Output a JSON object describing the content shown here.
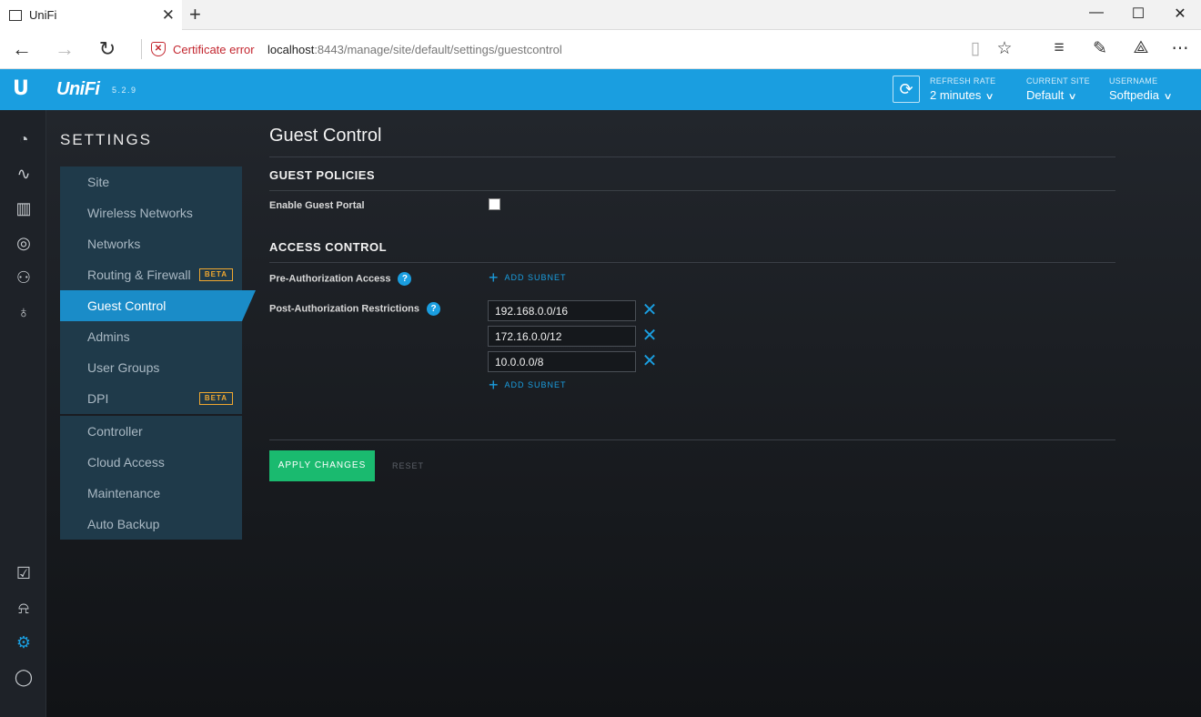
{
  "browser": {
    "tab_title": "UniFi",
    "tab_close": "✕",
    "new_tab": "+",
    "window_controls": {
      "minimize": "—",
      "maximize": "☐",
      "close": "✕"
    },
    "nav": {
      "back": "←",
      "forward": "→",
      "refresh": "↻"
    },
    "cert_error": "Certificate error",
    "url_host": "localhost",
    "url_path": ":8443/manage/site/default/settings/guestcontrol",
    "toolbar_icons": [
      "reading-view-icon",
      "favorite-star-icon",
      "hub-icon",
      "web-note-icon",
      "share-icon",
      "more-icon"
    ]
  },
  "header": {
    "brand": "UniFi",
    "version": "5.2.9",
    "refresh_rate_label": "REFRESH RATE",
    "refresh_rate_value": "2 minutes",
    "current_site_label": "CURRENT SITE",
    "current_site_value": "Default",
    "username_label": "USERNAME",
    "username_value": "Softpedia",
    "accent_color": "#1a9ee0"
  },
  "rail_icons": [
    "dashboard-icon",
    "statistics-icon",
    "map-icon",
    "devices-icon",
    "clients-icon",
    "insights-icon",
    "events-icon",
    "alerts-icon",
    "settings-icon",
    "chat-icon"
  ],
  "settings": {
    "title": "SETTINGS",
    "menu1": [
      {
        "label": "Site"
      },
      {
        "label": "Wireless Networks"
      },
      {
        "label": "Networks"
      },
      {
        "label": "Routing & Firewall",
        "badge": "BETA"
      },
      {
        "label": "Guest Control",
        "active": true
      },
      {
        "label": "Admins"
      },
      {
        "label": "User Groups"
      },
      {
        "label": "DPI",
        "badge": "BETA"
      }
    ],
    "menu2": [
      {
        "label": "Controller"
      },
      {
        "label": "Cloud Access"
      },
      {
        "label": "Maintenance"
      },
      {
        "label": "Auto Backup"
      }
    ]
  },
  "content": {
    "title": "Guest Control",
    "guest_policies_title": "GUEST POLICIES",
    "enable_portal_label": "Enable Guest Portal",
    "enable_portal_checked": false,
    "access_control_title": "ACCESS CONTROL",
    "pre_auth_label": "Pre-Authorization Access",
    "post_auth_label": "Post-Authorization Restrictions",
    "help_glyph": "?",
    "add_subnet_label": "ADD SUBNET",
    "subnets": [
      "192.168.0.0/16",
      "172.16.0.0/12",
      "10.0.0.0/8"
    ],
    "apply_label": "APPLY CHANGES",
    "reset_label": "RESET"
  }
}
